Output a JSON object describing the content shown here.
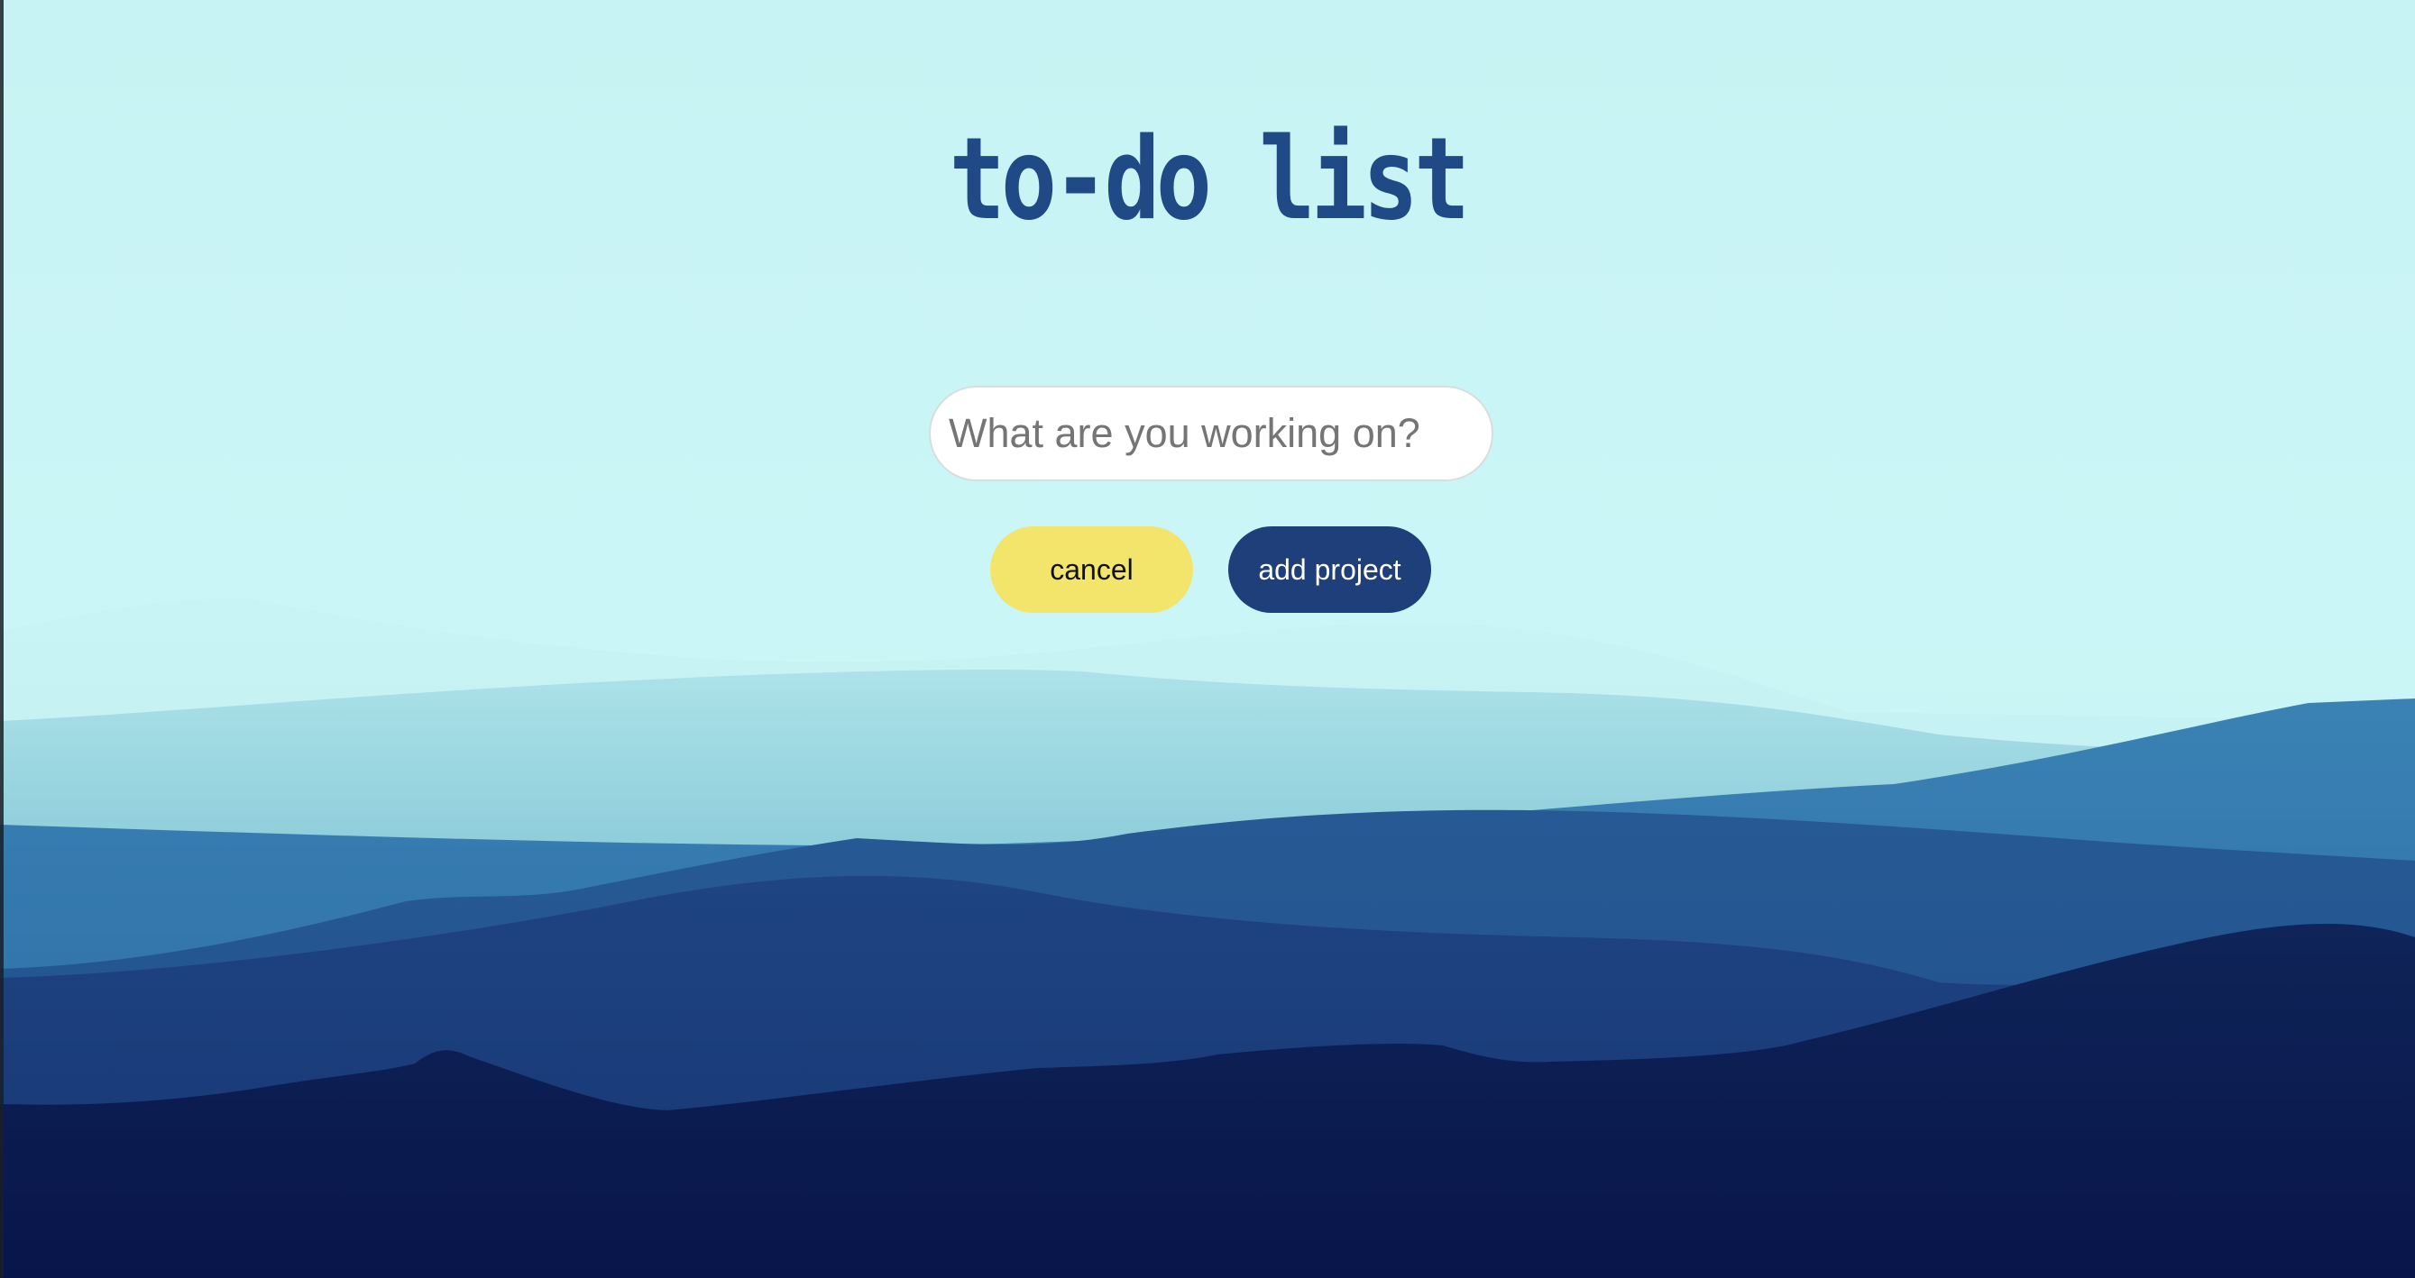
{
  "page": {
    "title": "to-do list"
  },
  "form": {
    "project_input": {
      "value": "",
      "placeholder": "What are you working on?"
    },
    "cancel_label": "cancel",
    "add_label": "add project"
  },
  "colors": {
    "sky": "#c9f4f5",
    "title": "#1f4a86",
    "cancel_button": "#f3e56c",
    "add_button": "#1e3f7a",
    "mountain_light": "#6fb8cf",
    "mountain_mid": "#2e6ca4",
    "mountain_dark": "#1b3d77",
    "mountain_darkest": "#0a1a4a"
  }
}
